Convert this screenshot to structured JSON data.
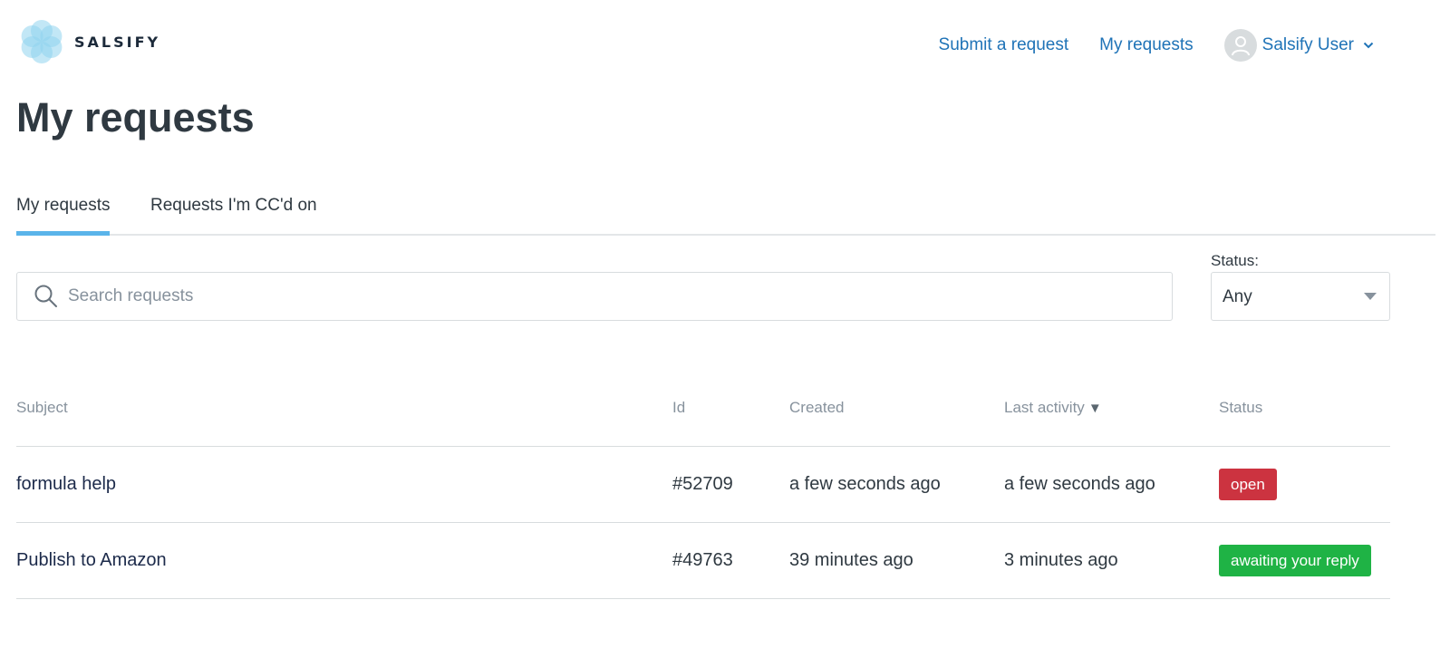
{
  "brand": {
    "name": "SALSIFY"
  },
  "nav": {
    "submit_request": "Submit a request",
    "my_requests": "My requests",
    "user_name": "Salsify User"
  },
  "page": {
    "title": "My requests"
  },
  "tabs": [
    {
      "label": "My requests",
      "active": true
    },
    {
      "label": "Requests I'm CC'd on",
      "active": false
    }
  ],
  "search": {
    "placeholder": "Search requests",
    "value": ""
  },
  "status_filter": {
    "label": "Status:",
    "selected": "Any"
  },
  "table": {
    "columns": {
      "subject": "Subject",
      "id": "Id",
      "created": "Created",
      "last_activity": "Last activity",
      "status": "Status"
    },
    "sort_indicator": "▼",
    "rows": [
      {
        "subject": "formula help",
        "id": "#52709",
        "created": "a few seconds ago",
        "last_activity": "a few seconds ago",
        "status": "open"
      },
      {
        "subject": "Publish to Amazon",
        "id": "#49763",
        "created": "39 minutes ago",
        "last_activity": "3 minutes ago",
        "status": "awaiting your reply"
      }
    ]
  },
  "colors": {
    "link": "#1f73b7",
    "tab_active": "#5ab4ea",
    "status_open": "#cc3340",
    "status_awaiting": "#1fb345"
  },
  "icons": {
    "logo": "salsify-flower-icon",
    "search": "search-icon",
    "avatar": "user-avatar-icon",
    "user_menu": "chevron-down-icon",
    "status_dropdown": "caret-down-icon"
  }
}
